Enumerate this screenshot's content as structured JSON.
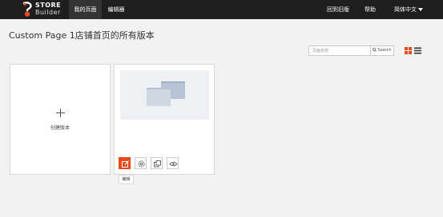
{
  "topbar": {
    "logo": {
      "line1": "STORE",
      "line2": "Builder"
    },
    "nav": {
      "my_pages": "我的页面",
      "editor": "编辑器"
    },
    "right": {
      "old_version": "回到旧版",
      "help": "帮助",
      "language": "简体中文"
    }
  },
  "page": {
    "title": "Custom Page 1店铺首页的所有版本"
  },
  "search": {
    "placeholder": "页面名称",
    "value": "",
    "button_label": "Search"
  },
  "colors": {
    "accent": "#e8491d",
    "topbar": "#1e1e1e",
    "active_nav": "#333333",
    "background": "#f2f2f2"
  },
  "new_version_card": {
    "label": "创建版本"
  },
  "version_card": {
    "actions": [
      {
        "name": "edit",
        "icon": "edit-icon"
      },
      {
        "name": "settings",
        "icon": "gear-icon"
      },
      {
        "name": "copy",
        "icon": "copy-icon"
      },
      {
        "name": "preview",
        "icon": "eye-icon"
      }
    ],
    "tooltip": "编辑"
  },
  "view_toggle": {
    "grid_icon": "grid-view-icon",
    "list_icon": "list-view-icon",
    "active": "grid"
  }
}
